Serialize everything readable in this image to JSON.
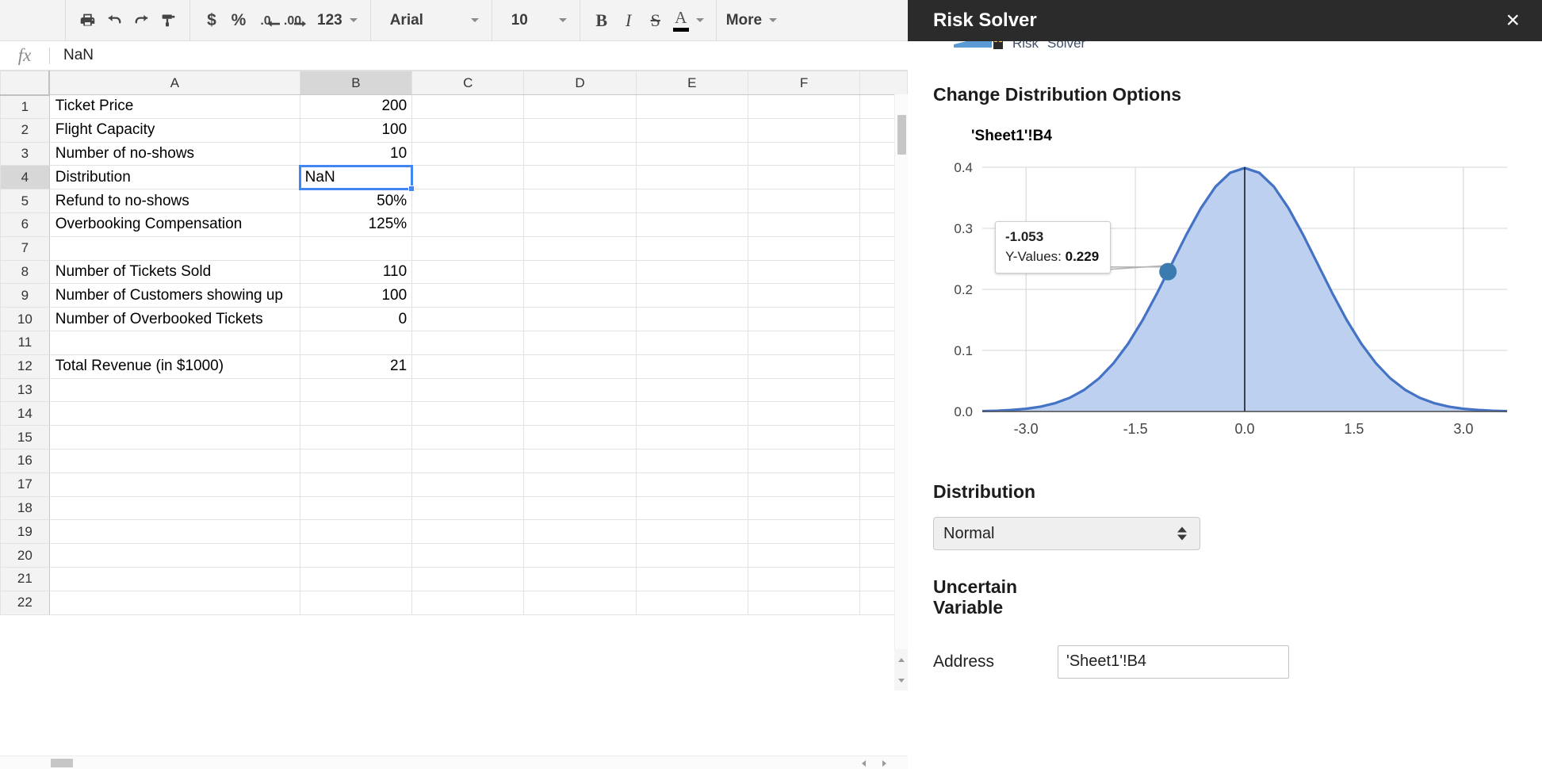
{
  "toolbar": {
    "buttons": [
      {
        "name": "print-icon",
        "label": "⎙",
        "title": "Print"
      },
      {
        "name": "undo-icon",
        "label": "↶",
        "title": "Undo"
      },
      {
        "name": "redo-icon",
        "label": "↷",
        "title": "Redo"
      },
      {
        "name": "paint-format-icon",
        "label": "✐",
        "title": "Paint format"
      }
    ],
    "currency_label": "$",
    "percent_label": "%",
    "decrease_decimal_label": ".0",
    "increase_decimal_label": ".00",
    "number_format_label": "123",
    "font_family": "Arial",
    "font_size": "10",
    "bold_label": "B",
    "italic_label": "I",
    "strikethrough_label": "S",
    "text_color_label": "A",
    "more_label": "More"
  },
  "formula_bar": {
    "fx_label": "fx",
    "value": "NaN",
    "placeholder": ""
  },
  "sheet": {
    "columns": [
      "A",
      "B",
      "C",
      "D",
      "E",
      "F",
      ""
    ],
    "selected_column": "B",
    "selected_row": 4,
    "active_cell_value": "NaN",
    "rows": [
      {
        "n": 1,
        "a": "Ticket Price",
        "b": "200"
      },
      {
        "n": 2,
        "a": "Flight Capacity",
        "b": "100"
      },
      {
        "n": 3,
        "a": "Number of no-shows",
        "b": "10"
      },
      {
        "n": 4,
        "a": "Distribution",
        "b": "NaN"
      },
      {
        "n": 5,
        "a": "Refund to no-shows",
        "b": "50%"
      },
      {
        "n": 6,
        "a": "Overbooking Compensation",
        "b": "125%"
      },
      {
        "n": 7,
        "a": "",
        "b": ""
      },
      {
        "n": 8,
        "a": "Number of Tickets Sold",
        "b": "110"
      },
      {
        "n": 9,
        "a": "Number of Customers showing up",
        "b": "100"
      },
      {
        "n": 10,
        "a": "Number of Overbooked Tickets",
        "b": "0"
      },
      {
        "n": 11,
        "a": "",
        "b": ""
      },
      {
        "n": 12,
        "a": "Total Revenue (in $1000)",
        "b": "21"
      },
      {
        "n": 13,
        "a": "",
        "b": ""
      },
      {
        "n": 14,
        "a": "",
        "b": ""
      },
      {
        "n": 15,
        "a": "",
        "b": ""
      },
      {
        "n": 16,
        "a": "",
        "b": ""
      },
      {
        "n": 17,
        "a": "",
        "b": ""
      },
      {
        "n": 18,
        "a": "",
        "b": ""
      },
      {
        "n": 19,
        "a": "",
        "b": ""
      },
      {
        "n": 20,
        "a": "",
        "b": ""
      },
      {
        "n": 21,
        "a": "",
        "b": ""
      },
      {
        "n": 22,
        "a": "",
        "b": ""
      }
    ]
  },
  "panel": {
    "title": "Risk Solver",
    "close_label": "×",
    "section_title": "Change Distribution Options",
    "distribution_label": "Distribution",
    "distribution_value": "Normal",
    "uncertain_variable_label_line1": "Uncertain",
    "uncertain_variable_label_line2": "Variable",
    "address_label": "Address",
    "address_value": "'Sheet1'!B4",
    "accent_color": "#4472c4",
    "fill_color": "#bdd0ef",
    "header_color": "#2b2b2b"
  },
  "chart_data": {
    "type": "area",
    "title": "'Sheet1'!B4",
    "xlabel": "",
    "ylabel": "",
    "xlim": [
      -3.6,
      3.6
    ],
    "ylim": [
      0.0,
      0.4
    ],
    "xticks": [
      "-3.0",
      "-1.5",
      "0.0",
      "1.5",
      "3.0"
    ],
    "xtick_values": [
      -3.0,
      -1.5,
      0.0,
      1.5,
      3.0
    ],
    "yticks": [
      "0.0",
      "0.1",
      "0.2",
      "0.3",
      "0.4"
    ],
    "ytick_values": [
      0.0,
      0.1,
      0.2,
      0.3,
      0.4
    ],
    "grid": true,
    "legend": "none",
    "series": [
      {
        "name": "Y-Values",
        "distribution": "normal",
        "mean": 0.0,
        "stddev": 1.0,
        "x": [
          -3.6,
          -3.4,
          -3.2,
          -3.0,
          -2.8,
          -2.6,
          -2.4,
          -2.2,
          -2.0,
          -1.8,
          -1.6,
          -1.4,
          -1.2,
          -1.0,
          -0.8,
          -0.6,
          -0.4,
          -0.2,
          0.0,
          0.2,
          0.4,
          0.6,
          0.8,
          1.0,
          1.2,
          1.4,
          1.6,
          1.8,
          2.0,
          2.2,
          2.4,
          2.6,
          2.8,
          3.0,
          3.2,
          3.4,
          3.6
        ],
        "values": [
          0.0006,
          0.0012,
          0.0024,
          0.0044,
          0.0079,
          0.0136,
          0.0224,
          0.0355,
          0.054,
          0.079,
          0.1109,
          0.1497,
          0.1942,
          0.242,
          0.2897,
          0.3332,
          0.3683,
          0.391,
          0.3989,
          0.391,
          0.3683,
          0.3332,
          0.2897,
          0.242,
          0.1942,
          0.1497,
          0.1109,
          0.079,
          0.054,
          0.0355,
          0.0224,
          0.0136,
          0.0079,
          0.0044,
          0.0024,
          0.0012,
          0.0006
        ]
      }
    ],
    "marker": {
      "x": -1.053,
      "y": 0.229
    },
    "vertical_line_x": 0.0,
    "tooltip": {
      "x_label": "-1.053",
      "series_label": "Y-Values:",
      "y_label": "0.229"
    }
  }
}
